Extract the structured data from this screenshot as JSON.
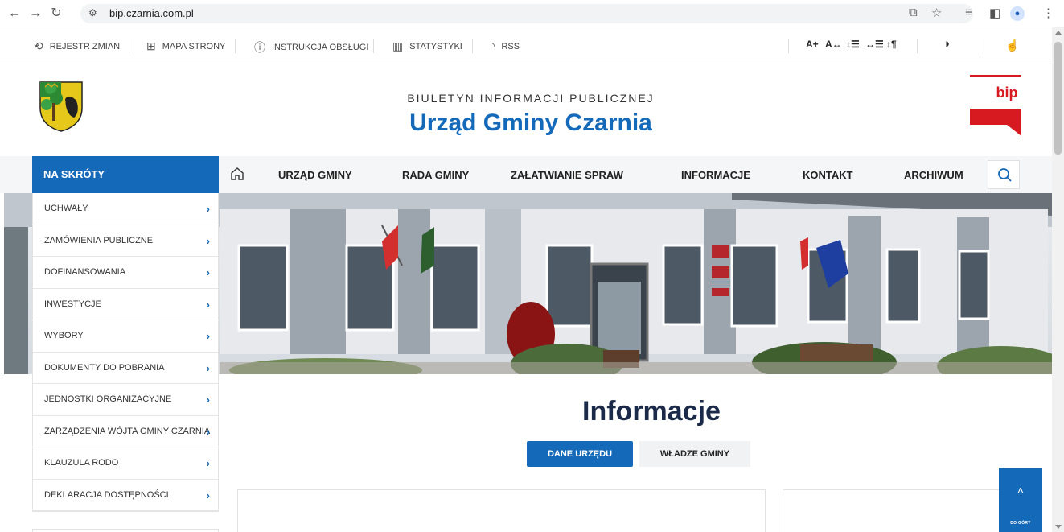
{
  "browser": {
    "url": "bip.czarnia.com.pl"
  },
  "utility_bar": {
    "items": [
      {
        "label": "REJESTR ZMIAN",
        "icon": "history-icon"
      },
      {
        "label": "MAPA STRONY",
        "icon": "sitemap-icon"
      },
      {
        "label": "INSTRUKCJA OBSŁUGI",
        "icon": "help-icon"
      },
      {
        "label": "STATYSTYKI",
        "icon": "chart-icon"
      },
      {
        "label": "RSS",
        "icon": "rss-icon"
      }
    ],
    "accessibility": {
      "font_larger": "A+",
      "letter_spacing": "A↔",
      "line_height": "↕☰",
      "word_spacing": "↔☰",
      "paragraph": "↕¶"
    }
  },
  "header": {
    "subtitle": "BIULETYN INFORMACJI PUBLICZNEJ",
    "title": "Urząd Gminy Czarnia",
    "bip_logo": "bip"
  },
  "main_nav": {
    "shortcuts_label": "NA SKRÓTY",
    "items": [
      "URZĄD GMINY",
      "RADA GMINY",
      "ZAŁATWIANIE SPRAW",
      "INFORMACJE",
      "KONTAKT",
      "ARCHIWUM"
    ]
  },
  "sidebar": {
    "items": [
      {
        "label": "UCHWAŁY"
      },
      {
        "label": "ZAMÓWIENIA PUBLICZNE"
      },
      {
        "label": "DOFINANSOWANIA"
      },
      {
        "label": "INWESTYCJE"
      },
      {
        "label": "WYBORY"
      },
      {
        "label": "DOKUMENTY DO POBRANIA"
      },
      {
        "label": "JEDNOSTKI ORGANIZACYJNE"
      },
      {
        "label": "ZARZĄDZENIA WÓJTA GMINY CZARNIA"
      },
      {
        "label": "KLAUZULA RODO"
      },
      {
        "label": "DEKLARACJA DOSTĘPNOŚCI"
      }
    ]
  },
  "content": {
    "heading": "Informacje",
    "tabs": [
      "DANE URZĘDU",
      "WŁADZE GMINY"
    ]
  },
  "back_to_top": {
    "label": "DO GÓRY"
  },
  "colors": {
    "brand_blue": "#1469b8",
    "bip_red": "#d71920"
  }
}
